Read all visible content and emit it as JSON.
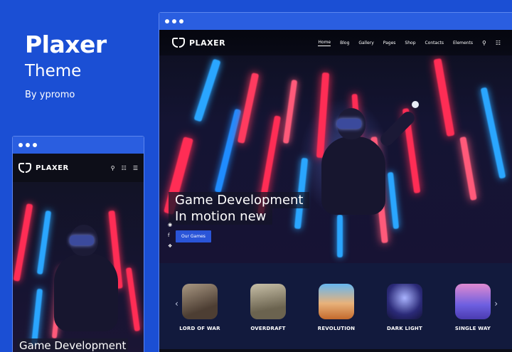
{
  "promo": {
    "title": "Plaxer",
    "subtitle": "Theme",
    "byline": "By ypromo"
  },
  "desktop": {
    "logo_text": "PLAXER",
    "nav": [
      {
        "label": "Home",
        "active": true
      },
      {
        "label": "Blog",
        "active": false
      },
      {
        "label": "Gallery",
        "active": false
      },
      {
        "label": "Pages",
        "active": false
      },
      {
        "label": "Shop",
        "active": false
      },
      {
        "label": "Contacts",
        "active": false
      },
      {
        "label": "Elements",
        "active": false
      }
    ],
    "hero": {
      "line1": "Game Development",
      "line2": "In motion new",
      "button": "Our Games"
    },
    "games": [
      {
        "label": "LORD OF WAR",
        "color": "#6b5a4a"
      },
      {
        "label": "OVERDRAFT",
        "color": "#7a7260"
      },
      {
        "label": "REVOLUTION",
        "color": "#d07a3b"
      },
      {
        "label": "DARK LIGHT",
        "color": "#3a3a9a"
      },
      {
        "label": "SINGLE WAY",
        "color": "#6a5ed0"
      }
    ]
  },
  "mobile": {
    "logo_text": "PLAXER",
    "hero_text": "Game Development"
  },
  "colors": {
    "background": "#1b4fd4",
    "accent": "#2a55d8",
    "neon_red": "#ff2d55",
    "neon_blue": "#2aa6ff"
  }
}
